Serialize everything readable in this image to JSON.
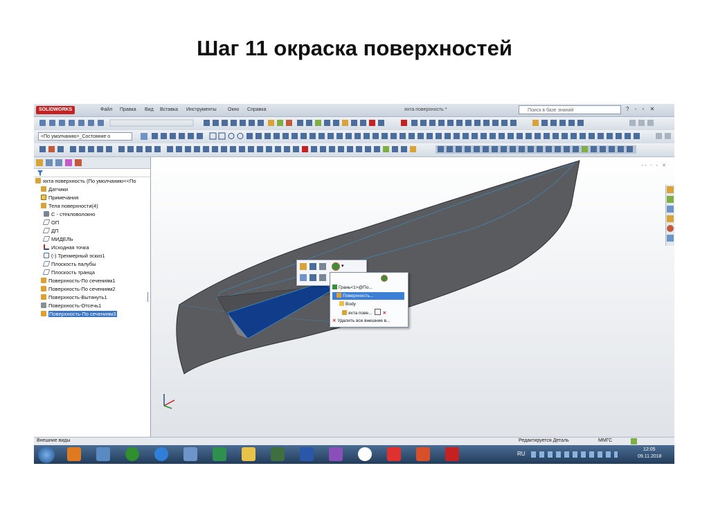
{
  "slide": {
    "title": "Шаг 11 окраска поверхностей"
  },
  "app": {
    "logo": "SOLIDWORKS",
    "menu": [
      "Файл",
      "Правка",
      "Вид",
      "Вставка",
      "Инструменты",
      "Окно",
      "Справка"
    ],
    "document_title": "яхта поверхность *",
    "search_placeholder": "Поиск в базе знаний"
  },
  "config_dropdown": {
    "value": "<По умолчанию>_Состояние о"
  },
  "feature_tree": {
    "root": "яхта поверхность  (По умолчанию<<По",
    "items": [
      "Датчики",
      "Примечания",
      "Тела поверхности(4)",
      "С - стекловолокно",
      "ОП",
      "ДП",
      "МИДЕЛЬ",
      "Исходная точка",
      "(-) Трехмерный эскиз1",
      "Плоскость палубы",
      "Плоскость транца",
      "Поверхность-По сечениям1",
      "Поверхность-По сечениям2",
      "Поверхность-Вытянуть1",
      "Поверхность-Отсечь1",
      "Поверхность-По сечениям3"
    ],
    "selected_index": 15
  },
  "context_menu": {
    "items": [
      "Грань<1>@По...",
      "Поверхность...",
      "Body",
      "яхта пове...",
      "Удалить все внешние в..."
    ],
    "highlighted_index": 1
  },
  "status_bar": {
    "left": "Внешние виды",
    "mode": "Редактируется Деталь",
    "units": "ММГС"
  },
  "taskbar": {
    "lang": "RU",
    "time": "12:05",
    "date": "09.11.2018"
  },
  "colors": {
    "hull": "#5a5b5e",
    "selected_face": "#103c8a",
    "selection_highlight": "#3b7fd6"
  }
}
